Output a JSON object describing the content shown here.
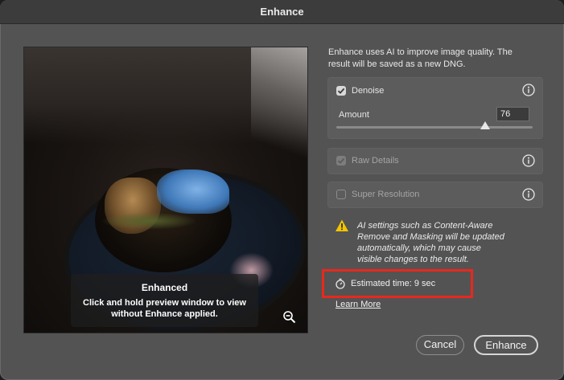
{
  "window": {
    "title": "Enhance"
  },
  "preview": {
    "overlay_title": "Enhanced",
    "overlay_line1": "Click and hold preview window to view",
    "overlay_line2": "without Enhance applied.",
    "zoom_icon": "zoom-out-icon"
  },
  "panel": {
    "intro_line1": "Enhance uses AI to improve image quality. The",
    "intro_line2": "result will be saved as a new DNG.",
    "denoise": {
      "label": "Denoise",
      "checked": true,
      "amount_label": "Amount",
      "amount_value": "76",
      "amount_fraction": 0.76
    },
    "raw_details": {
      "label": "Raw Details",
      "checked": true,
      "disabled": true
    },
    "super_resolution": {
      "label": "Super Resolution",
      "checked": false,
      "disabled": true
    },
    "warning": {
      "line1": "AI settings such as Content-Aware",
      "line2": "Remove and Masking will be updated",
      "line3": "automatically, which may cause",
      "line4": "visible changes to the result."
    },
    "estimated_time": "Estimated time: 9 sec",
    "learn_more": "Learn More"
  },
  "buttons": {
    "cancel": "Cancel",
    "enhance": "Enhance"
  },
  "colors": {
    "dialog_bg": "#535353",
    "highlight_border": "#e8281d",
    "warning_yellow": "#f2c500"
  }
}
